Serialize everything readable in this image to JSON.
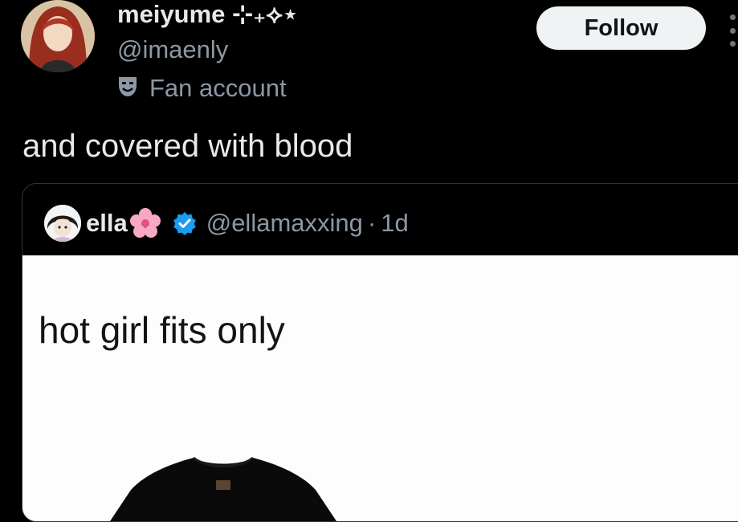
{
  "author": {
    "display_name": "meiyume ⊹₊⟡⋆",
    "handle": "@imaenly",
    "badge_label": "Fan account",
    "badge_icon": "theater-mask-icon",
    "avatar_icon": "anime-avatar"
  },
  "follow_button": {
    "label": "Follow"
  },
  "more_icon": "more-vertical-icon",
  "tweet": {
    "text": "and covered with blood"
  },
  "quoted": {
    "display_name": "ella",
    "name_emoji": "cherry-blossom-icon",
    "verified": true,
    "handle": "@ellamaxxing",
    "separator": "·",
    "time": "1d",
    "image_text": "hot girl fits only"
  },
  "colors": {
    "background": "#000000",
    "primary_text": "#e7e9ea",
    "secondary_text": "#8b98a5",
    "follow_bg": "#eff3f4",
    "verified_blue": "#1d9bf0",
    "border": "#2f3336"
  }
}
